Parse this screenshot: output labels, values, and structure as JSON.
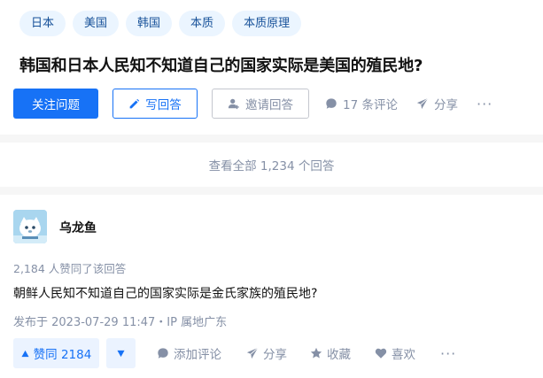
{
  "question": {
    "tags": [
      "日本",
      "美国",
      "韩国",
      "本质",
      "本质原理"
    ],
    "title": "韩国和日本人民知不知道自己的国家实际是美国的殖民地?",
    "actions": {
      "follow": "关注问题",
      "write_answer": "写回答",
      "invite": "邀请回答",
      "comments": "17 条评论",
      "share": "分享",
      "more": "···"
    }
  },
  "view_all": "查看全部 1,234 个回答",
  "answer": {
    "author": "乌龙鱼",
    "vote_summary": "2,184 人赞同了该回答",
    "content": "朝鲜人民知不知道自己的国家实际是金氏家族的殖民地?",
    "published": "发布于 2023-07-29 11:47・IP 属地广东",
    "actions": {
      "vote_up": "赞同 2184",
      "add_comment": "添加评论",
      "share": "分享",
      "collect": "收藏",
      "like": "喜欢",
      "more": "···"
    }
  },
  "colors": {
    "primary": "#1772f6",
    "tag_bg": "#ebf5ff",
    "tag_text": "#175199",
    "muted": "#8590a6"
  }
}
